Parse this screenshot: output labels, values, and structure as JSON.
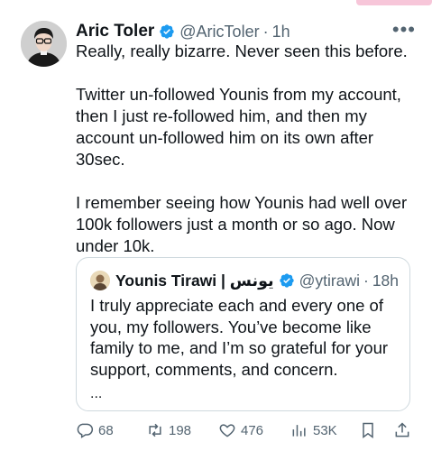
{
  "post": {
    "author_name": "Aric Toler",
    "handle": "@AricToler",
    "separator": "·",
    "time": "1h",
    "text": [
      "Really, really bizarre. Never seen this before.",
      "",
      "Twitter un-followed Younis from my account, then I just re-followed him, and then my account un-followed him on its own after 30sec.",
      "",
      "I remember seeing how Younis had well over 100k followers just a month or so ago. Now under 10k."
    ]
  },
  "quote": {
    "author_name": "Younis Tirawi | يونس",
    "handle": "@ytirawi",
    "separator": "·",
    "time": "18h",
    "text": "I truly appreciate each and every one of you, my followers. You’ve become like family to me, and I’m so grateful for your support, comments, and concern.",
    "ellipsis": "..."
  },
  "actions": {
    "replies": "68",
    "reposts": "198",
    "likes": "476",
    "views": "53K"
  },
  "colors": {
    "verified_blue": "#1d9bf0",
    "muted_text": "#536471",
    "border": "#cfd9de"
  }
}
